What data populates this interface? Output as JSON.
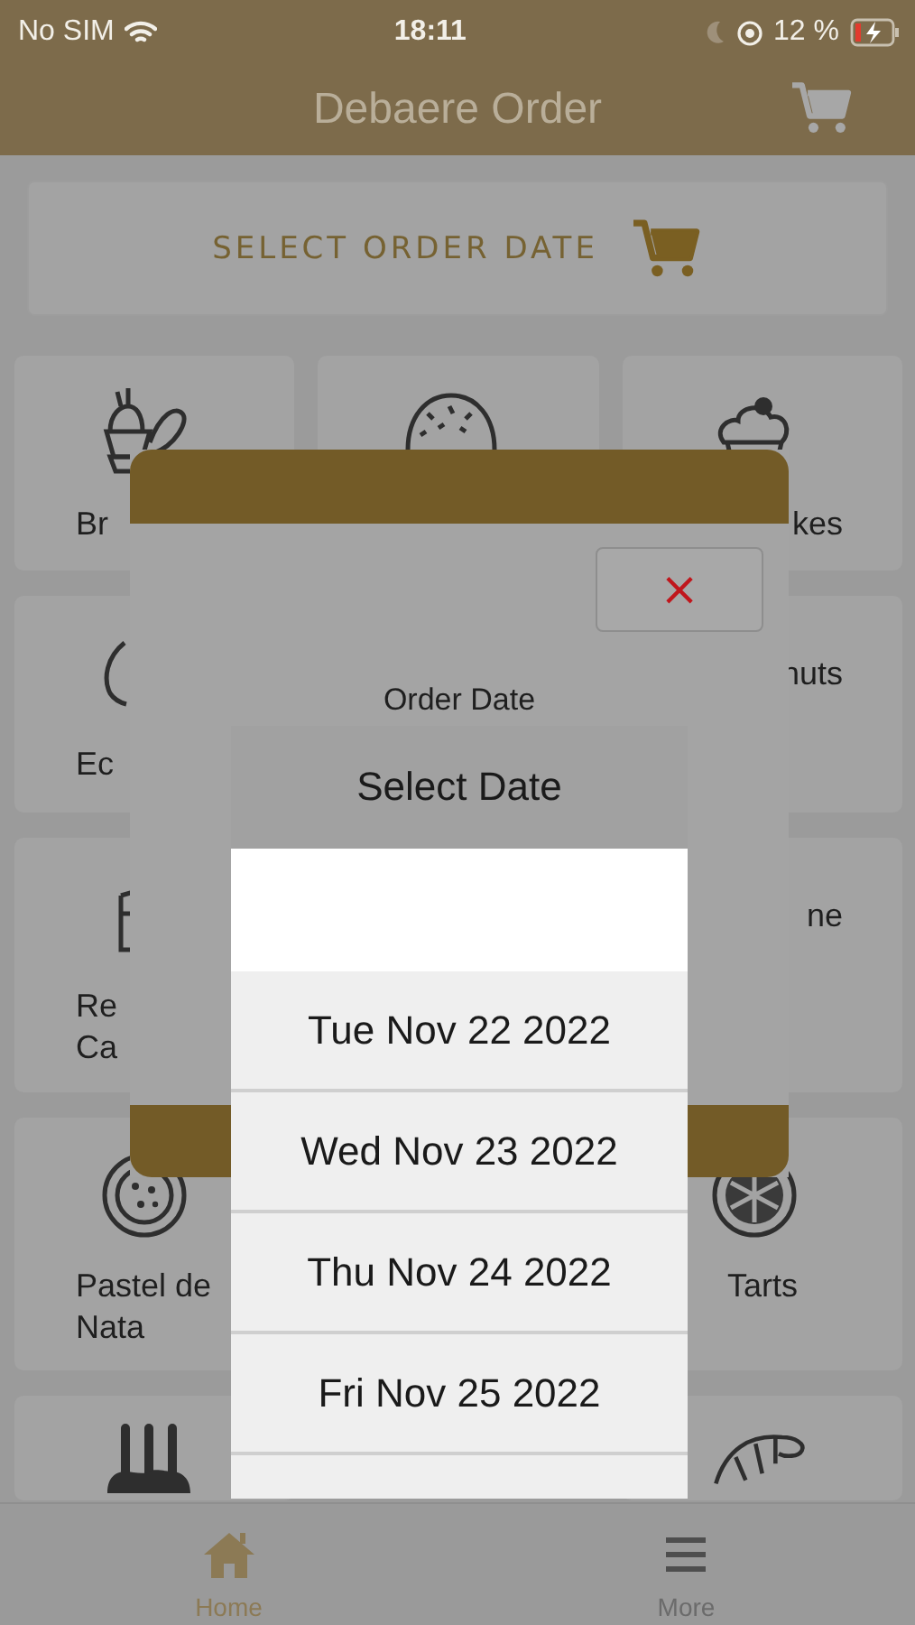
{
  "status_bar": {
    "carrier": "No SIM",
    "time": "18:11",
    "battery": "12 %"
  },
  "nav_bar": {
    "title": "Debaere Order"
  },
  "order_date_button": {
    "label": "SELECT ORDER DATE"
  },
  "category_rows": [
    {
      "left": {
        "label": "Br"
      },
      "middle": {},
      "right": {
        "label": "kes"
      }
    },
    {
      "left": {
        "label": "Ec"
      },
      "right": {
        "label": "nuts"
      }
    },
    {
      "left": {
        "label": "Re\nCa"
      },
      "right": {
        "label": "ne"
      }
    },
    {
      "left": {
        "label": "Pastel de Nata"
      },
      "right": {
        "label": "Tarts"
      }
    },
    {
      "left": {},
      "right": {}
    }
  ],
  "modal": {
    "close_label": "×",
    "field_label": "Order Date"
  },
  "date_picker": {
    "title": "Select Date",
    "options": [
      "Tue Nov 22 2022",
      "Wed Nov 23 2022",
      "Thu Nov 24 2022",
      "Fri Nov 25 2022"
    ]
  },
  "tab_bar": [
    {
      "label": "Home",
      "selected": true
    },
    {
      "label": "More",
      "selected": false
    }
  ]
}
